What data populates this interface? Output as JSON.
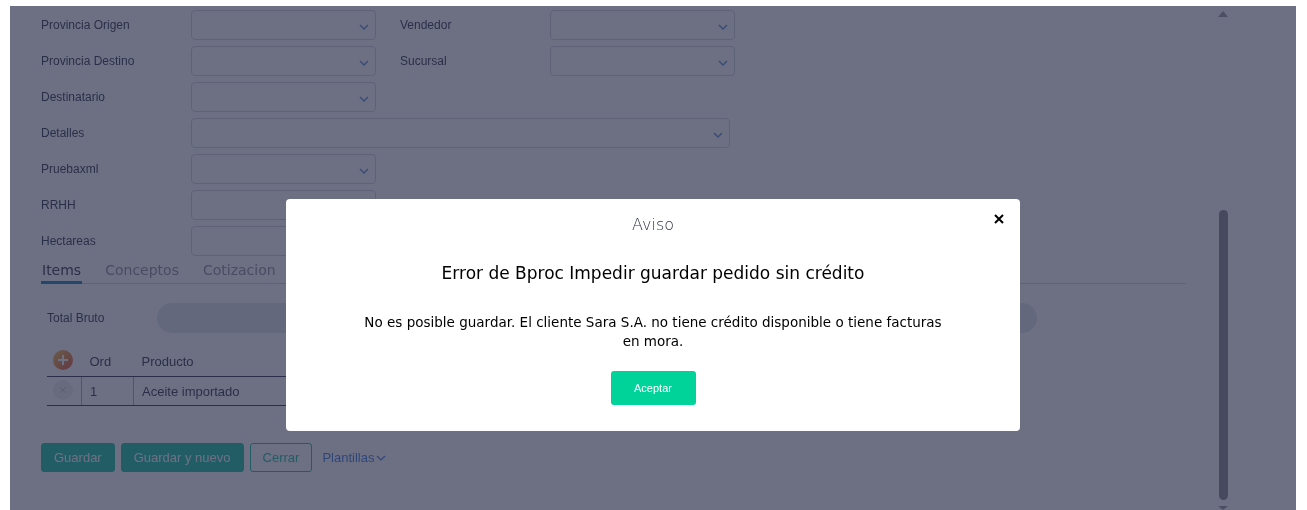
{
  "form": {
    "rows": [
      [
        {
          "label": "Provincia Origen",
          "kind": "select"
        },
        {
          "label": "Vendedor",
          "kind": "select"
        }
      ],
      [
        {
          "label": "Provincia Destino",
          "kind": "select"
        },
        {
          "label": "Sucursal",
          "kind": "select"
        }
      ],
      [
        {
          "label": "Destinatario",
          "kind": "select"
        }
      ],
      [
        {
          "label": "Detalles",
          "kind": "wide_select"
        }
      ],
      [
        {
          "label": "Pruebaxml",
          "kind": "select"
        }
      ],
      [
        {
          "label": "RRHH",
          "kind": "input"
        }
      ],
      [
        {
          "label": "Hectareas",
          "kind": "input"
        }
      ]
    ]
  },
  "tabs": [
    {
      "label": "Items",
      "selected": true
    },
    {
      "label": "Conceptos",
      "selected": false
    },
    {
      "label": "Cotizacion",
      "selected": false
    }
  ],
  "totals": {
    "label": "Total Bruto"
  },
  "table": {
    "columns": [
      "Ord",
      "Producto"
    ],
    "rows": [
      {
        "cells": [
          "1",
          "Aceite importado"
        ]
      }
    ]
  },
  "buttons": [
    {
      "label": "Guardar",
      "kind": "primary"
    },
    {
      "label": "Guardar y nuevo",
      "kind": "primary"
    },
    {
      "label": "Cerrar",
      "kind": "outline"
    },
    {
      "label": "Plantillas",
      "kind": "link"
    }
  ],
  "dialog": {
    "title": "Aviso",
    "heading": "Error de Bproc Impedir guardar pedido sin crédito",
    "message": "No es posible guardar. El cliente Sara S.A. no tiene crédito disponible o tiene facturas en mora.",
    "button": "Aceptar"
  }
}
